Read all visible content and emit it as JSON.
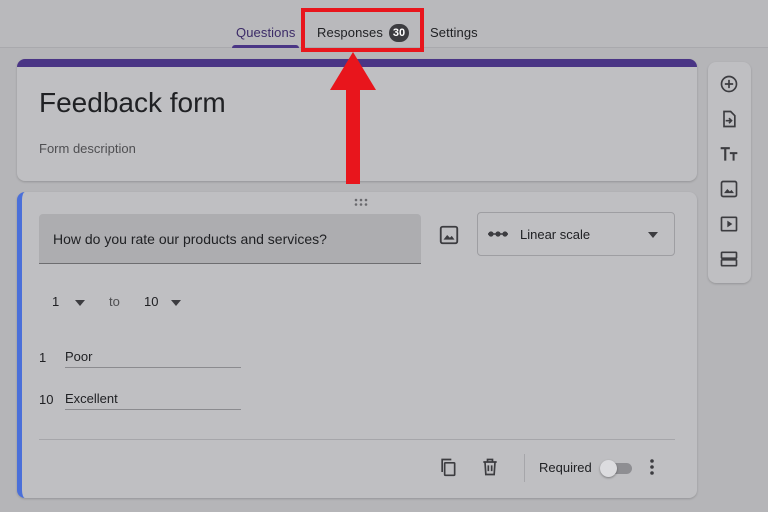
{
  "tabs": {
    "questions": "Questions",
    "responses": "Responses",
    "responses_count": "30",
    "settings": "Settings"
  },
  "form": {
    "title": "Feedback form",
    "description": "Form description"
  },
  "question": {
    "text": "How do you rate our products and services?",
    "type": "Linear scale",
    "scale_from": "1",
    "scale_to_word": "to",
    "scale_to": "10",
    "low_number": "1",
    "low_label": "Poor",
    "high_number": "10",
    "high_label": "Excellent",
    "required_label": "Required",
    "required": false
  },
  "sidebar": {
    "icons": [
      "add-question-icon",
      "import-questions-icon",
      "add-title-icon",
      "add-image-icon",
      "add-video-icon",
      "add-section-icon"
    ]
  },
  "colors": {
    "accent": "#4a3585",
    "highlight": "#e8151c",
    "active_card": "#4a6fd9"
  }
}
